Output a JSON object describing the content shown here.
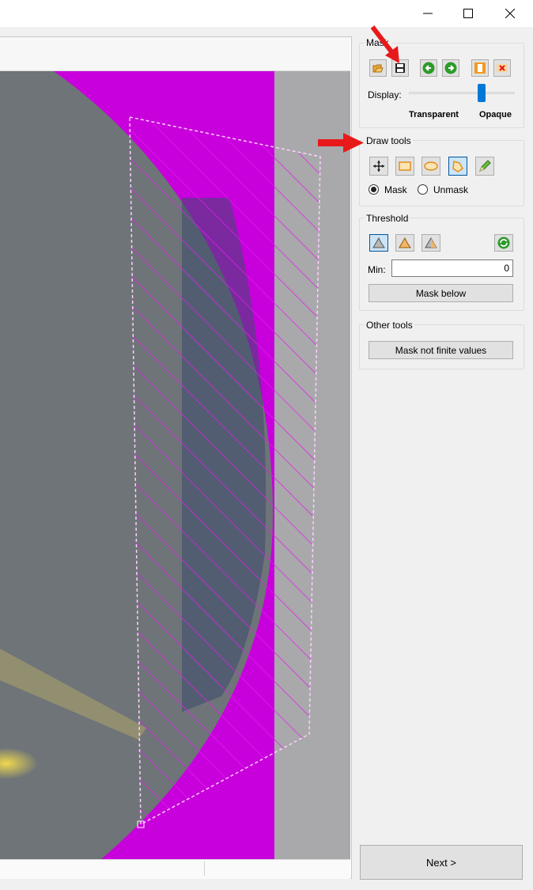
{
  "window": {
    "minimize_glyph": "—",
    "maximize_glyph": "☐",
    "close_glyph": "✕"
  },
  "mask": {
    "title": "Mask",
    "tools": [
      {
        "name": "load-mask",
        "icon": "folder-open-icon"
      },
      {
        "name": "save-mask",
        "icon": "floppy-disk-icon"
      },
      {
        "name": "undo",
        "icon": "arrow-left-icon"
      },
      {
        "name": "redo",
        "icon": "arrow-right-icon"
      },
      {
        "name": "invert-mask",
        "icon": "invert-icon"
      },
      {
        "name": "clear-mask",
        "icon": "clear-icon"
      }
    ],
    "display_label": "Display:",
    "slider_min_label": "Transparent",
    "slider_max_label": "Opaque",
    "slider_value": 0.7
  },
  "draw_tools": {
    "title": "Draw tools",
    "tools": [
      {
        "name": "pan",
        "icon": "move-icon"
      },
      {
        "name": "rectangle",
        "icon": "rectangle-icon"
      },
      {
        "name": "ellipse",
        "icon": "ellipse-icon"
      },
      {
        "name": "polygon",
        "icon": "polygon-icon",
        "active": true
      },
      {
        "name": "pencil",
        "icon": "pencil-icon"
      }
    ],
    "mode_options": [
      "Mask",
      "Unmask"
    ],
    "selected_mode": "Mask"
  },
  "threshold": {
    "title": "Threshold",
    "min_label": "Min:",
    "min_value": "0",
    "mask_below_label": "Mask below"
  },
  "other_tools": {
    "title": "Other tools",
    "mask_not_finite_label": "Mask not finite values"
  },
  "next_label": "Next >",
  "colors": {
    "mask": "#c800dc",
    "polygon_outline": "#ffd0ff",
    "annotation_arrow": "#e8191b",
    "image_bg": "#6e7478",
    "image_shadow": "#3c4a6e",
    "beam": "#e6c84a"
  }
}
